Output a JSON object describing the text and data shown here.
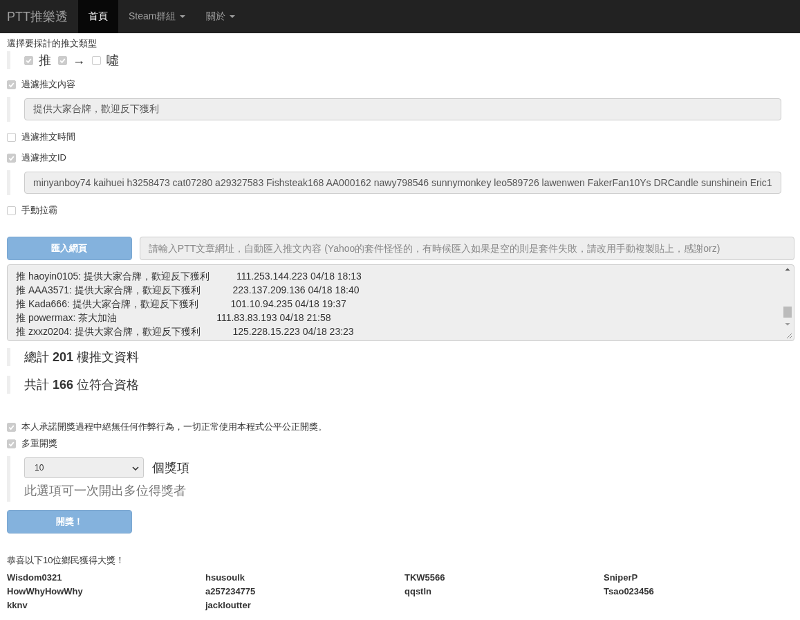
{
  "navbar": {
    "brand": "PTT推樂透",
    "items": [
      {
        "label": "首頁",
        "selected": true,
        "dropdown": false
      },
      {
        "label": "Steam群組",
        "selected": false,
        "dropdown": true
      },
      {
        "label": "關於",
        "selected": false,
        "dropdown": true
      }
    ]
  },
  "push_types": {
    "label": "選擇要採計的推文類型",
    "options": [
      {
        "label": "推",
        "checked": true
      },
      {
        "label": "→",
        "checked": true
      },
      {
        "label": "噓",
        "checked": false
      }
    ]
  },
  "filters": [
    {
      "label": "過濾推文內容",
      "checked": true,
      "value": "提供大家合牌，歡迎反下獲利"
    },
    {
      "label": "過濾推文時間",
      "checked": false
    },
    {
      "label": "過濾推文ID",
      "checked": true,
      "value": "minyanboy74 kaihuei h3258473 cat07280 a29327583 Fishsteak168 AA000162 nawy798546 sunnymonkey leo589726 lawenwen FakerFan10Ys DRCandle sunshinein Eric1"
    },
    {
      "label": "手動拉霸",
      "checked": false
    }
  ],
  "import": {
    "button": "匯入網頁",
    "placeholder": "請輸入PTT文章網址，自動匯入推文內容 (Yahoo的套件怪怪的，有時候匯入如果是空的則是套件失敗，請改用手動複製貼上，感謝orz)"
  },
  "comments": [
    "推 haoyin0105: 提供大家合牌，歡迎反下獲利          111.253.144.223 04/18 18:13",
    "推 AAA3571: 提供大家合牌，歡迎反下獲利            223.137.209.136 04/18 18:40",
    "推 Kada666: 提供大家合牌，歡迎反下獲利            101.10.94.235 04/18 19:37",
    "推 powermax: 茶大加油                                     111.83.83.193 04/18 21:58",
    "推 zxxz0204: 提供大家合牌，歡迎反下獲利            125.228.15.223 04/18 23:23"
  ],
  "totals": [
    "總計 **201** 樓推文資料",
    "共計 **166** 位符合資格"
  ],
  "options": [
    {
      "label": "本人承諾開獎過程中絕無任何作弊行為，一切正常使用本程式公平公正開獎。",
      "checked": true
    },
    {
      "label": "多重開獎",
      "checked": true
    }
  ],
  "prize_count": {
    "value": "10",
    "suffix": "個獎項",
    "help": "此選項可一次開出多位得獎者"
  },
  "draw_button": "開獎！",
  "result": {
    "heading": "恭喜以下10位鄉民獲得大獎！",
    "winners": [
      "Wisdom0321",
      "hsusoulk",
      "TKW5566",
      "SniperP",
      "HowWhyHowWhy",
      "a257234775",
      "qqstln",
      "Tsao023456",
      "kknv",
      "jackloutter"
    ]
  }
}
